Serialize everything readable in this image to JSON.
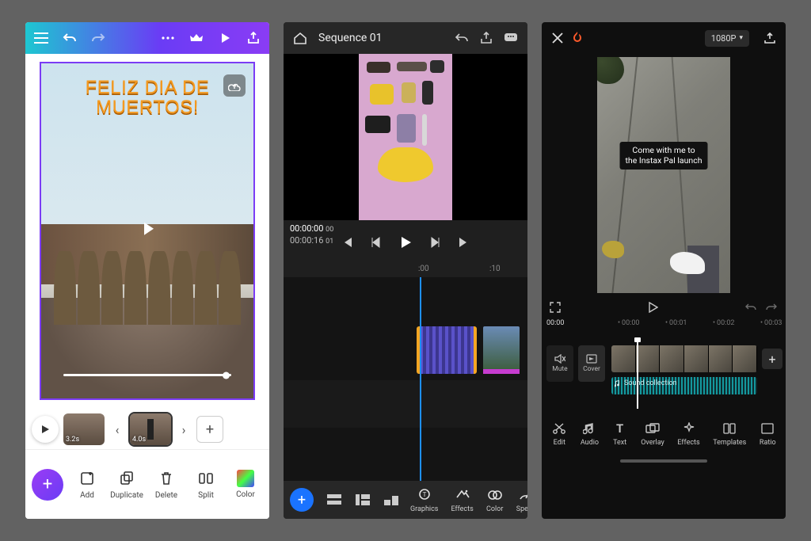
{
  "app1": {
    "overlay_text": "FELIZ DIA DE\nMUERTOS!",
    "clips": [
      {
        "duration": "3.2s"
      },
      {
        "duration": "4.0s"
      }
    ],
    "tools": {
      "add": "Add",
      "duplicate": "Duplicate",
      "delete": "Delete",
      "split": "Split",
      "color": "Color"
    }
  },
  "app2": {
    "sequence_title": "Sequence 01",
    "time_current": "00:00:00",
    "time_current_frame": "00",
    "time_total": "00:00:16",
    "time_total_frame": "01",
    "ruler": {
      "mark_a": ":00",
      "mark_b": ":10"
    },
    "tools": {
      "graphics": "Graphics",
      "effects": "Effects",
      "color": "Color",
      "speed": "Speed"
    }
  },
  "app3": {
    "resolution": "1080P",
    "caption": "Come with me to\nthe Instax Pal launch",
    "time_current": "00:00",
    "ruler": {
      "m0": "00:00",
      "m1": "00:01",
      "m2": "00:02",
      "m3": "00:03"
    },
    "track_tools": {
      "mute": "Mute",
      "cover": "Cover"
    },
    "audio_label": "Sound collection",
    "tools": {
      "edit": "Edit",
      "audio": "Audio",
      "text": "Text",
      "overlay": "Overlay",
      "effects": "Effects",
      "templates": "Templates",
      "ratio": "Ratio"
    }
  }
}
